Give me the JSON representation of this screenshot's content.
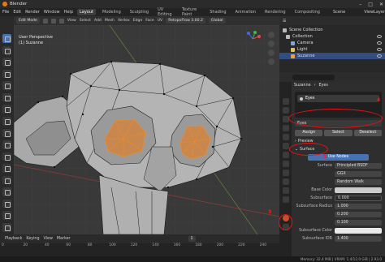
{
  "window": {
    "title": "Blender",
    "controls": [
      "–",
      "□",
      "✕"
    ]
  },
  "menubar": {
    "menus": [
      "File",
      "Edit",
      "Render",
      "Window",
      "Help"
    ],
    "workspaces": [
      "Layout",
      "Modeling",
      "Sculpting",
      "UV Editing",
      "Texture Paint",
      "Shading",
      "Animation",
      "Rendering",
      "Compositing"
    ],
    "active_workspace": "Layout",
    "scene": "Scene",
    "view_layer": "ViewLayer"
  },
  "viewport_header": {
    "mode": "Edit Mode",
    "menus": [
      "View",
      "Select",
      "Add",
      "Mesh",
      "Vertex",
      "Edge",
      "Face",
      "UV"
    ],
    "retopo": "RetopoFlow 3.00.2",
    "transform": "Global"
  },
  "viewport": {
    "perspective": "User Perspective",
    "object": "(1) Suzanne"
  },
  "outliner": {
    "header": "Scene Collection",
    "items": [
      {
        "label": "Scene Collection",
        "icon": "collection-icon"
      },
      {
        "label": "Collection",
        "icon": "collection-icon"
      },
      {
        "label": "Camera",
        "icon": "camera-icon"
      },
      {
        "label": "Light",
        "icon": "light-icon"
      },
      {
        "label": "Suzanne",
        "icon": "mesh-icon",
        "selected": true
      }
    ]
  },
  "properties": {
    "breadcrumb": [
      "Suzanne",
      "Eyes"
    ],
    "slot_item": "Eyes",
    "material_name": "Eyes",
    "buttons": {
      "assign": "Assign",
      "select": "Select",
      "deselect": "Deselect"
    },
    "sections": {
      "preview": "Preview",
      "surface": "Surface"
    },
    "use_nodes": "Use Nodes",
    "props": [
      {
        "label": "Surface",
        "value": "Principled BSDF"
      },
      {
        "label": "",
        "value": "GGX"
      },
      {
        "label": "",
        "value": "Random Walk"
      },
      {
        "label": "Base Color",
        "value": ""
      },
      {
        "label": "Subsurface",
        "value": "0.000"
      },
      {
        "label": "Subsurface Radius",
        "value": "1.000"
      },
      {
        "label": "",
        "value": "0.200"
      },
      {
        "label": "",
        "value": "0.100"
      },
      {
        "label": "Subsurface Color",
        "value": ""
      },
      {
        "label": "Subsurface IOR",
        "value": "1.400"
      }
    ]
  },
  "timeline": {
    "menus": [
      "Playback",
      "Keying",
      "View",
      "Marker"
    ],
    "frame": "1",
    "ticks": [
      "0",
      "20",
      "40",
      "60",
      "80",
      "100",
      "120",
      "140",
      "160",
      "180",
      "200",
      "220",
      "240"
    ]
  },
  "statusbar": {
    "text": "Memory: 32.4 MiB | VRAM: 1.4/12.0 GiB | 2.93.0"
  },
  "annotations": [
    "4",
    "5",
    "3"
  ],
  "colors": {
    "accent": "#4772b3",
    "selection": "#e87d0d",
    "annotation": "#e11111"
  }
}
